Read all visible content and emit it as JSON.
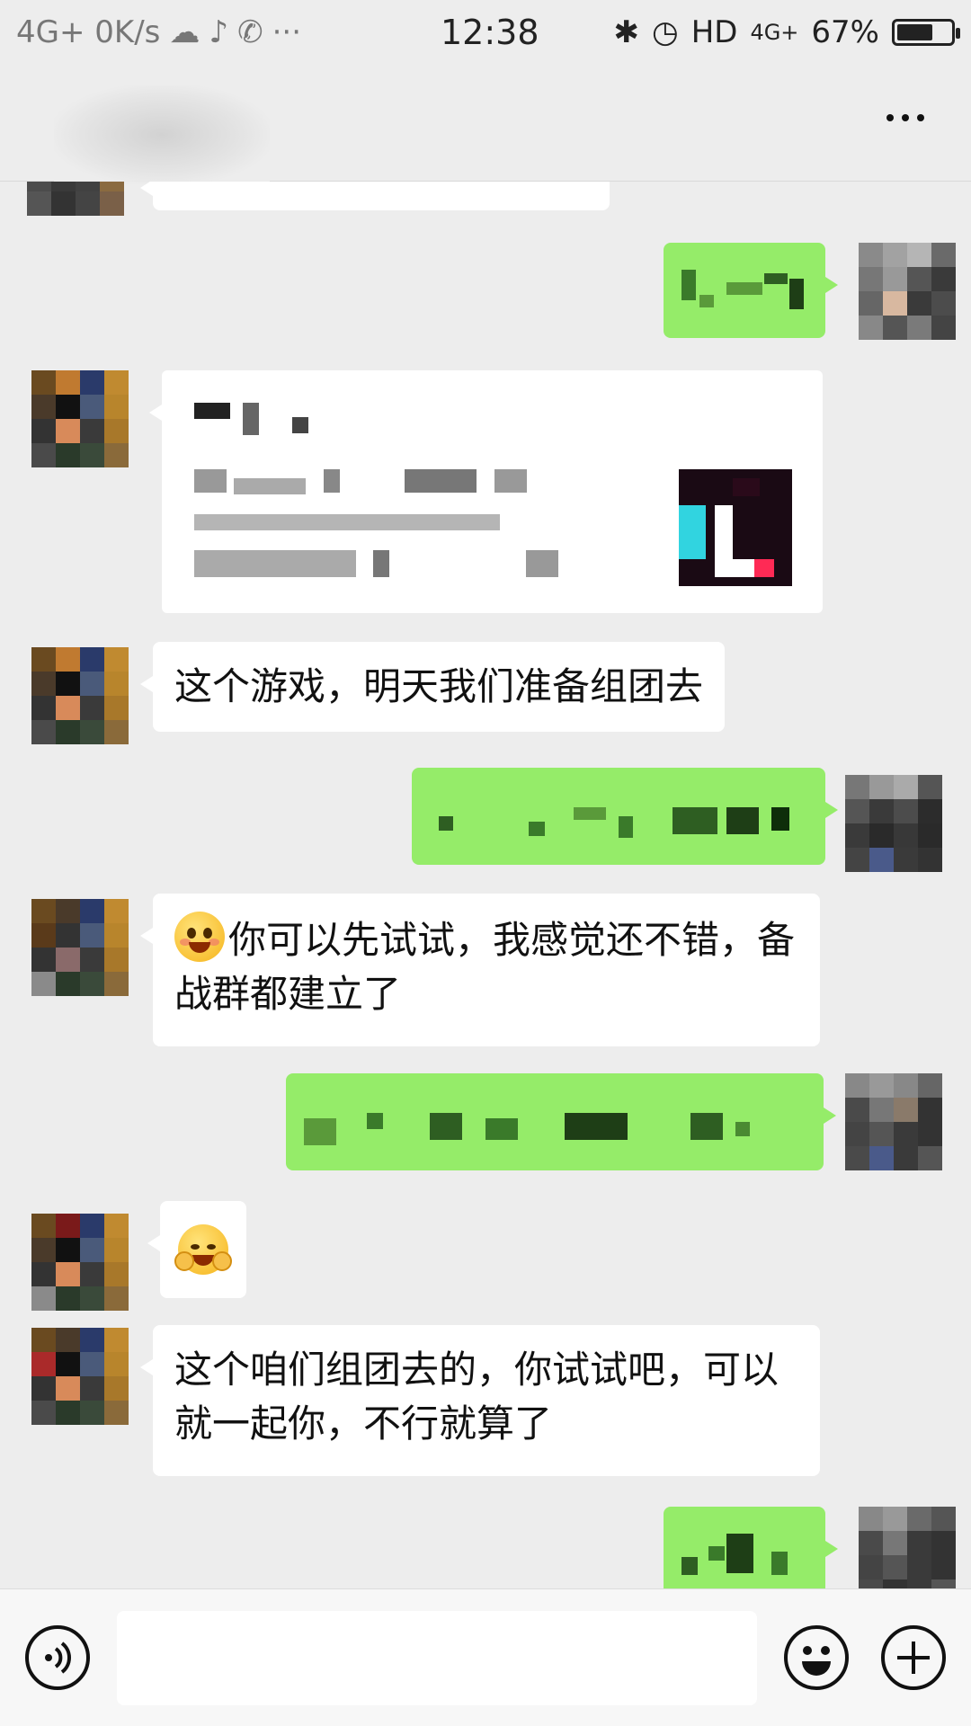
{
  "status_bar": {
    "left_text": "4G+ 0K/s",
    "time": "12:38",
    "hd": "HD",
    "network": "4G+",
    "battery_text": "67%",
    "battery_level": 0.67
  },
  "nav": {
    "more_icon": "more-dots-icon"
  },
  "messages": [
    {
      "side": "left",
      "type": "text",
      "text": "这个游戏，明天我们准备组团去"
    },
    {
      "side": "left",
      "type": "text",
      "emoji": "grin-emoji",
      "text": "你可以先试试，我感觉还不错，备战群都建立了"
    },
    {
      "side": "left",
      "type": "emoji",
      "emoji": "facepalm-laugh-emoji"
    },
    {
      "side": "left",
      "type": "text",
      "text": "这个咱们组团去的，你试试吧，可以就一起你，不行就算了"
    }
  ],
  "input": {
    "value": "",
    "placeholder": ""
  },
  "colors": {
    "background": "#ededed",
    "bubble_green": "#95ec69",
    "bubble_white": "#ffffff",
    "bottom_bar": "#f7f7f7"
  }
}
